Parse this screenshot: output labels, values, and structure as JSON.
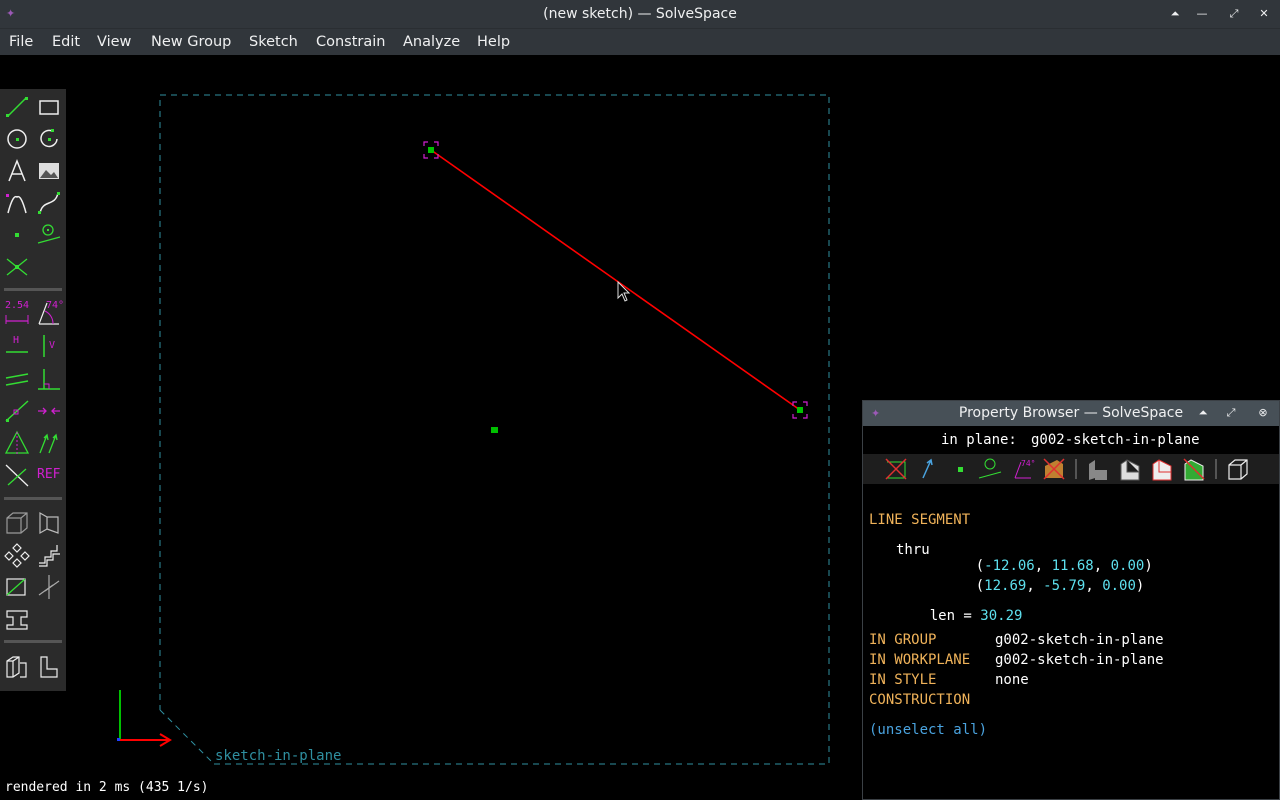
{
  "window": {
    "title": "(new sketch) — SolveSpace"
  },
  "menu": [
    {
      "label": "File"
    },
    {
      "label": "Edit"
    },
    {
      "label": "View"
    },
    {
      "label": "New Group"
    },
    {
      "label": "Sketch"
    },
    {
      "label": "Constrain"
    },
    {
      "label": "Analyze"
    },
    {
      "label": "Help"
    }
  ],
  "toolbar": {
    "dimension_label": "2.54",
    "angle_label": "74°",
    "horizontal_label": "H",
    "vertical_label": "V",
    "reference_label": "REF"
  },
  "canvas": {
    "workplane_label": "sketch-in-plane",
    "colors": {
      "line": "#ff0000",
      "point": "#00c000",
      "selection": "#d020d0",
      "workplane_border": "#2f8fa0",
      "axis_x": "#ff0000",
      "axis_y": "#00c000"
    }
  },
  "status": {
    "text": "rendered in 2 ms (435 1/s)"
  },
  "property_browser": {
    "title": "Property Browser — SolveSpace",
    "in_plane_label": "in plane:",
    "in_plane_value": "g002-sketch-in-plane",
    "heading": "LINE SEGMENT",
    "thru_label": "thru",
    "p1": {
      "open": "(",
      "x": "-12.06",
      "y": "11.68",
      "z": "0.00",
      "close": ")"
    },
    "p2": {
      "open": "(",
      "x": "12.69",
      "y": "-5.79",
      "z": "0.00",
      "close": ")"
    },
    "sep": ", ",
    "len_label": "len = ",
    "len_value": "30.29",
    "in_group_label": "IN GROUP",
    "in_group_value": "g002-sketch-in-plane",
    "in_workplane_label": "IN WORKPLANE",
    "in_workplane_value": "g002-sketch-in-plane",
    "in_style_label": "IN STYLE",
    "in_style_value": "none",
    "construction_label": "CONSTRUCTION",
    "unselect_label": "(unselect all)"
  }
}
